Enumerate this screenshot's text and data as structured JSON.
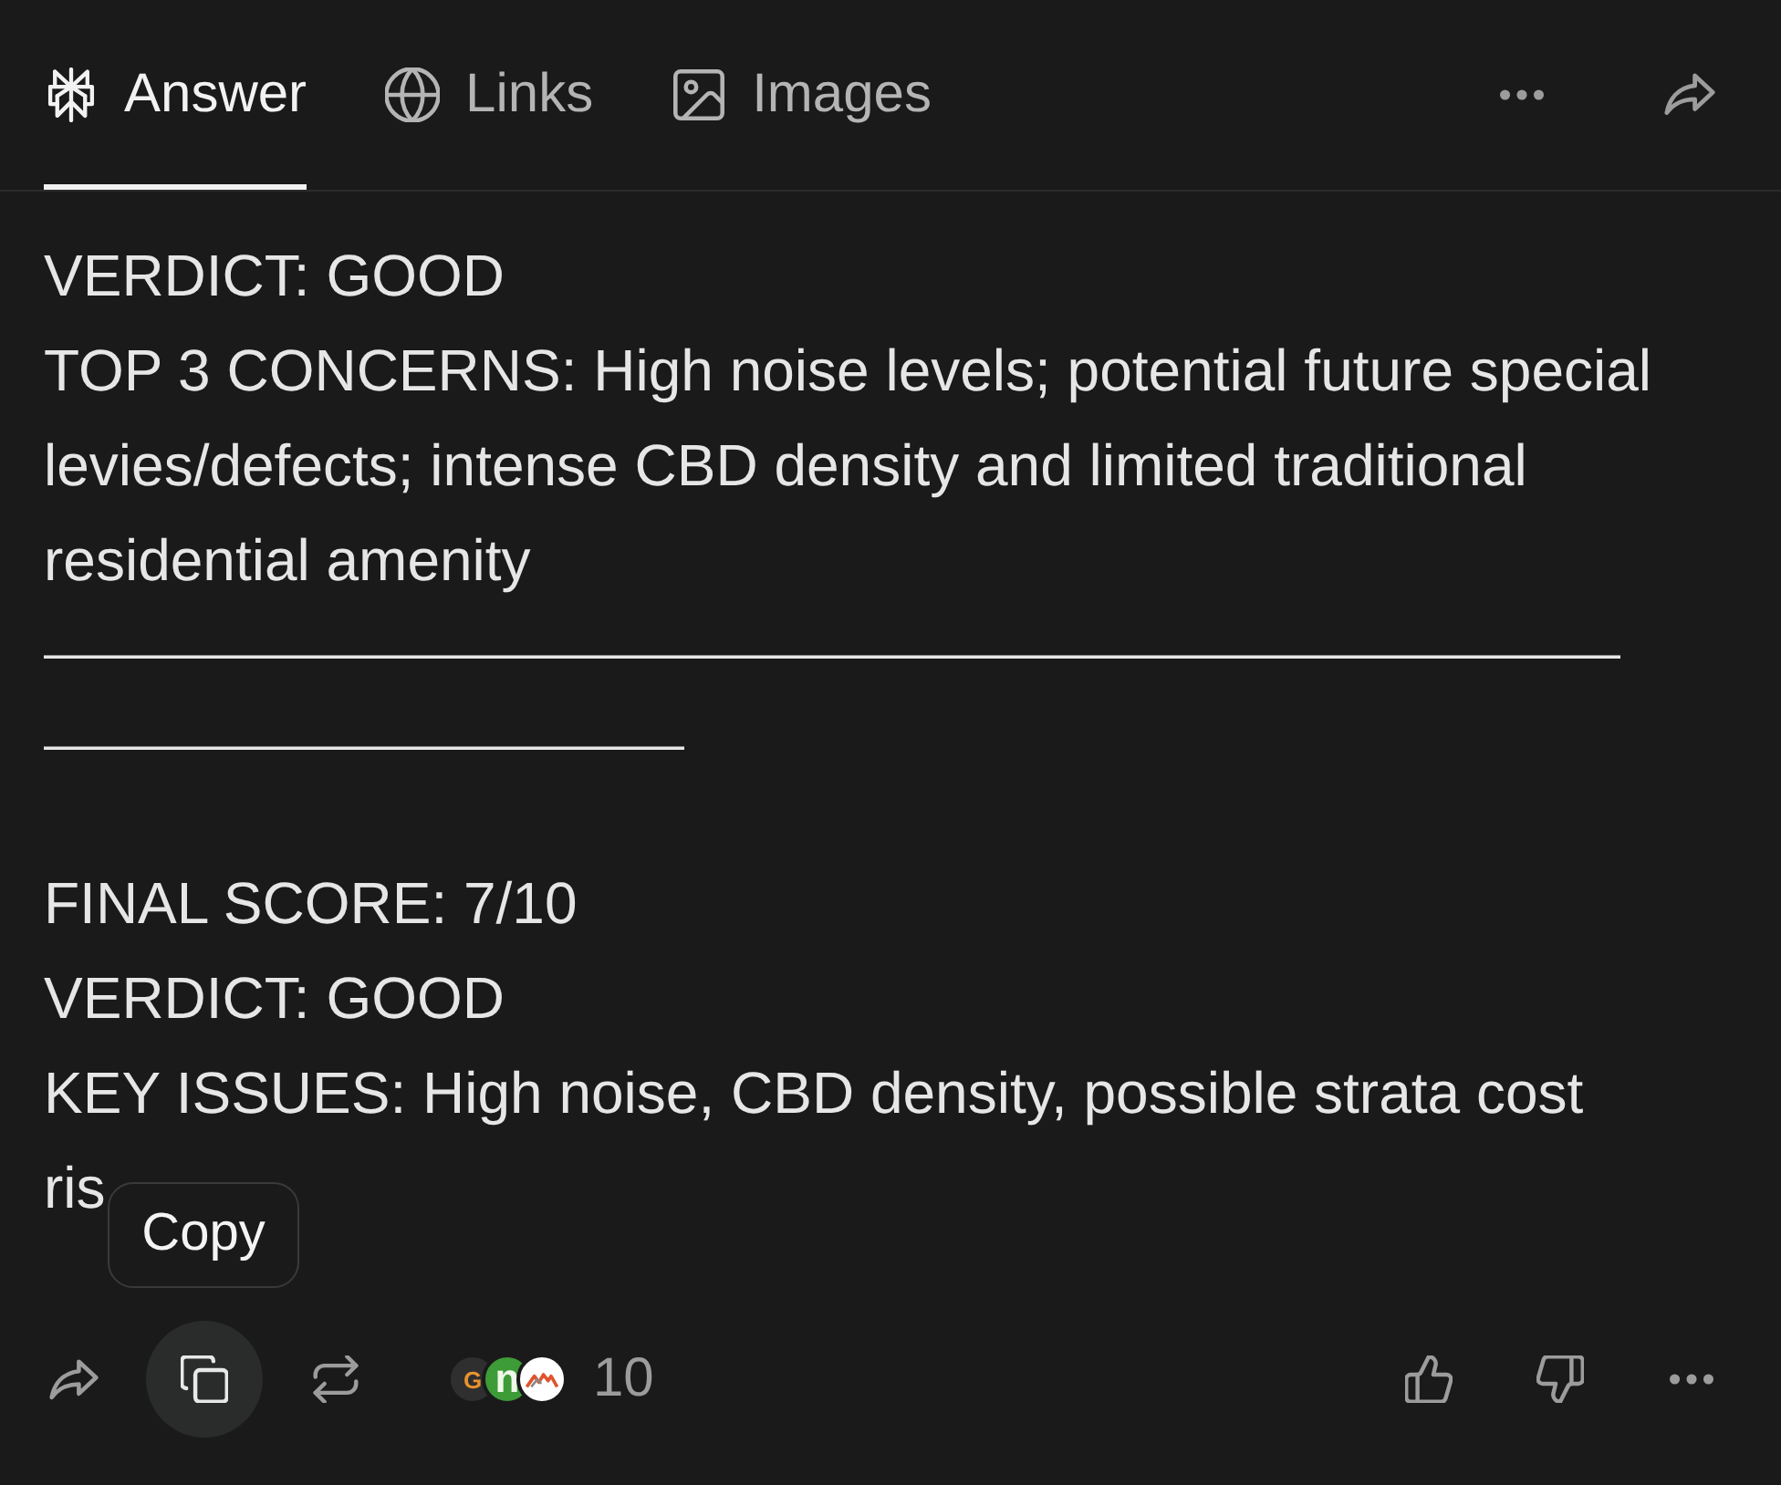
{
  "header": {
    "tabs": [
      {
        "label": "Answer",
        "selected": true
      },
      {
        "label": "Links",
        "selected": false
      },
      {
        "label": "Images",
        "selected": false
      }
    ]
  },
  "answer": {
    "blocks": [
      {
        "kind": "text",
        "text": "VERDICT: GOOD"
      },
      {
        "kind": "text",
        "text": "TOP 3 CONCERNS: High noise levels; potential future special levies/defects; intense CBD density and limited traditional residential amenity"
      },
      {
        "kind": "rule",
        "text": "—————————————————————————————————————————————"
      },
      {
        "kind": "text",
        "text": "FINAL SCORE: 7/10"
      },
      {
        "kind": "text",
        "text": "VERDICT: GOOD"
      },
      {
        "kind": "text",
        "text": "KEY ISSUES: High noise, CBD density, possible strata cost ris"
      }
    ]
  },
  "actions": {
    "copy": {
      "highlighted": true,
      "tooltip": "Copy"
    },
    "sources": {
      "favicons": [
        {
          "kind": "letter",
          "text": "G",
          "color": "#2f2f2f"
        },
        {
          "kind": "letter",
          "text": "n",
          "color": "#3d9b38"
        },
        {
          "kind": "mountains",
          "color": "#ffffff"
        }
      ],
      "count": "10"
    }
  }
}
